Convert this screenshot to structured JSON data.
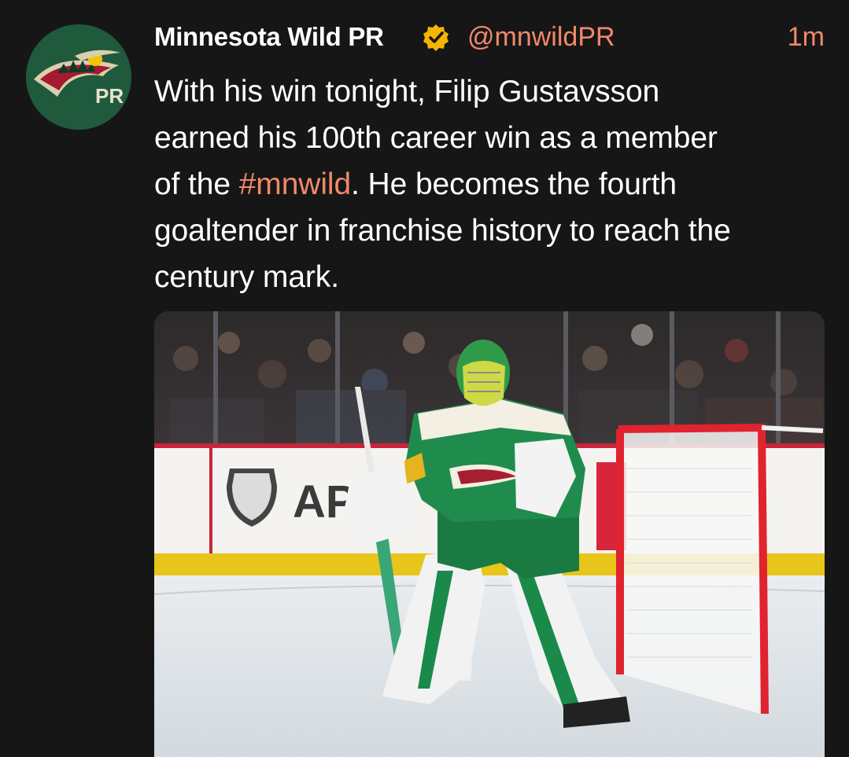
{
  "tweet": {
    "author": {
      "display_name": "Minnesota Wild PR",
      "handle": "@mnwildPR",
      "verified": true,
      "avatar_text": "PR"
    },
    "timestamp": "1m",
    "text_lines": [
      {
        "before": "With his win tonight, Filip Gustavsson",
        "hashtag": "",
        "after": ""
      },
      {
        "before": "earned his 100th career win as a member",
        "hashtag": "",
        "after": ""
      },
      {
        "before": "of the ",
        "hashtag": "#mnwild",
        "after": ". He becomes the fourth"
      },
      {
        "before": "goaltender in franchise history to reach the",
        "hashtag": "",
        "after": ""
      },
      {
        "before": "century mark.",
        "hashtag": "",
        "after": ""
      }
    ],
    "media": {
      "board_text": "AP"
    }
  },
  "colors": {
    "background": "#161616",
    "accent": "#f0896a",
    "verified_badge": "#f5b400",
    "wild_green": "#1f5a3d"
  },
  "icons": {
    "verified": "verified-badge-icon"
  }
}
